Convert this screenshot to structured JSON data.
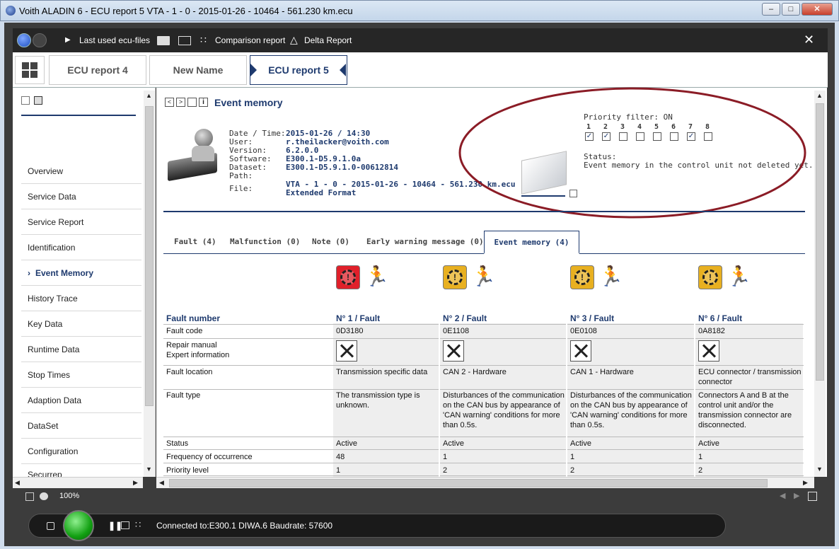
{
  "window": {
    "title": "Voith ALADIN 6 - ECU report 5 VTA - 1 - 0 - 2015-01-26 - 10464 - 561.230 km.ecu"
  },
  "toolbar": {
    "last_used": "Last used ecu-files",
    "comparison": "Comparison report",
    "delta": "Delta Report"
  },
  "report_tabs": [
    "ECU report 4",
    "New Name",
    "ECU report 5"
  ],
  "sidebar": {
    "items": [
      "Overview",
      "Service Data",
      "Service Report",
      "Identification",
      "Event Memory",
      "History Trace",
      "Key Data",
      "Runtime Data",
      "Stop Times",
      "Adaption Data",
      "DataSet",
      "Configuration",
      "Securrep"
    ],
    "active": "Event Memory"
  },
  "page": {
    "title": "Event memory"
  },
  "info": {
    "labels": [
      "Date / Time:",
      "User:",
      "Version:",
      "Software:",
      "Dataset:",
      "Path:",
      "File:"
    ],
    "values": [
      "2015-01-26 / 14:30",
      "r.theilacker@voith.com",
      "6.2.0.0",
      "E300.1-D5.9.1.0a",
      "E300.1-D5.9.1.0-00612814",
      "",
      "VTA - 1 - 0 - 2015-01-26 - 10464 - 561.230 km.ecu",
      "Extended Format"
    ]
  },
  "priority": {
    "label": "Priority filter: ON",
    "numbers": [
      "1",
      "2",
      "3",
      "4",
      "5",
      "6",
      "7",
      "8"
    ],
    "checked": [
      true,
      true,
      false,
      false,
      false,
      false,
      true,
      false
    ],
    "status_label": "Status:",
    "status_text": "Event memory in the control unit not deleted yet."
  },
  "fault_tabs": [
    "Fault (4)",
    "Malfunction (0)",
    "Note (0)",
    "Early warning message (0)",
    "Event memory (4)"
  ],
  "table": {
    "row_labels": {
      "fault_number": "Fault number",
      "fault_code": "Fault code",
      "repair1": "Repair manual",
      "repair2": "Expert information",
      "location": "Fault location",
      "type": "Fault type",
      "status": "Status",
      "frequency": "Frequency of occurrence",
      "priority": "Priority level"
    },
    "columns": [
      {
        "header": "N° 1 / Fault",
        "code": "0D3180",
        "location": "Transmission specific data",
        "type": "The transmission type is unknown.",
        "status": "Active",
        "frequency": "48",
        "priority": "1",
        "icon_color": "#e0202a"
      },
      {
        "header": "N° 2 / Fault",
        "code": "0E1108",
        "location": "CAN 2 - Hardware",
        "type": "Disturbances of the communication on the CAN bus by appearance of 'CAN warning' conditions for more than 0.5s.",
        "status": "Active",
        "frequency": "1",
        "priority": "2",
        "icon_color": "#e8b020"
      },
      {
        "header": "N° 3 / Fault",
        "code": "0E0108",
        "location": "CAN 1 - Hardware",
        "type": "Disturbances of the communication on the CAN bus by appearance of 'CAN warning' conditions for more than 0.5s.",
        "status": "Active",
        "frequency": "1",
        "priority": "2",
        "icon_color": "#e8b020"
      },
      {
        "header": "N° 6 / Fault",
        "code": "0A8182",
        "location": "ECU connector / transmission connector",
        "type": "Connectors A and B at the control unit and/or the transmission connector are disconnected.",
        "status": "Active",
        "frequency": "1",
        "priority": "2",
        "icon_color": "#e8b020"
      }
    ]
  },
  "statusbar": {
    "zoom": "100%"
  },
  "bottombar": {
    "connection": "Connected to:E300.1  DIWA.6 Baudrate: 57600"
  }
}
